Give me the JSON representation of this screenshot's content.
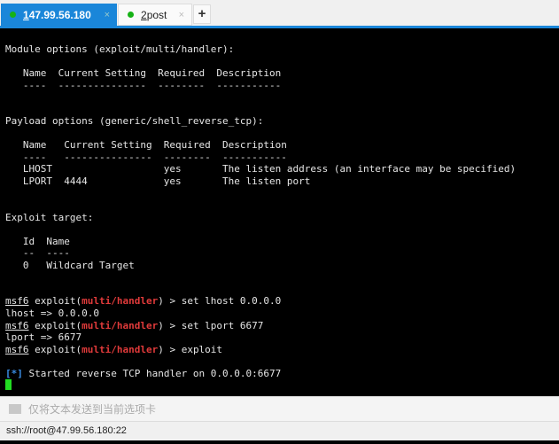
{
  "tabs": [
    {
      "num": "1",
      "label": " 47.99.56.180",
      "active": true,
      "close": "×"
    },
    {
      "num": "2",
      "label": " post",
      "active": false,
      "close": "×"
    }
  ],
  "new_tab": "+",
  "terminal": {
    "lines": [
      [
        [
          "Module options (exploit/multi/handler):",
          ""
        ]
      ],
      [
        [
          "",
          ""
        ]
      ],
      [
        [
          "   Name  Current Setting  Required  Description",
          ""
        ]
      ],
      [
        [
          "   ----  ---------------  --------  -----------",
          ""
        ]
      ],
      [
        [
          "",
          ""
        ]
      ],
      [
        [
          "",
          ""
        ]
      ],
      [
        [
          "Payload options (generic/shell_reverse_tcp):",
          ""
        ]
      ],
      [
        [
          "",
          ""
        ]
      ],
      [
        [
          "   Name   Current Setting  Required  Description",
          ""
        ]
      ],
      [
        [
          "   ----   ---------------  --------  -----------",
          ""
        ]
      ],
      [
        [
          "   LHOST                   yes       The listen address (an interface may be specified)",
          ""
        ]
      ],
      [
        [
          "   LPORT  4444             yes       The listen port",
          ""
        ]
      ],
      [
        [
          "",
          ""
        ]
      ],
      [
        [
          "",
          ""
        ]
      ],
      [
        [
          "Exploit target:",
          ""
        ]
      ],
      [
        [
          "",
          ""
        ]
      ],
      [
        [
          "   Id  Name",
          ""
        ]
      ],
      [
        [
          "   --  ----",
          ""
        ]
      ],
      [
        [
          "   0   Wildcard Target",
          ""
        ]
      ],
      [
        [
          "",
          ""
        ]
      ],
      [
        [
          "",
          ""
        ]
      ],
      [
        [
          "msf6",
          "msf"
        ],
        [
          " exploit(",
          ""
        ],
        [
          "multi/handler",
          "red"
        ],
        [
          ") > set lhost 0.0.0.0",
          ""
        ]
      ],
      [
        [
          "lhost => 0.0.0.0",
          ""
        ]
      ],
      [
        [
          "msf6",
          "msf"
        ],
        [
          " exploit(",
          ""
        ],
        [
          "multi/handler",
          "red"
        ],
        [
          ") > set lport 6677",
          ""
        ]
      ],
      [
        [
          "lport => 6677",
          ""
        ]
      ],
      [
        [
          "msf6",
          "msf"
        ],
        [
          " exploit(",
          ""
        ],
        [
          "multi/handler",
          "red"
        ],
        [
          ") > exploit",
          ""
        ]
      ],
      [
        [
          "",
          ""
        ]
      ],
      [
        [
          "[*]",
          "blue"
        ],
        [
          " Started reverse TCP handler on 0.0.0.0:6677",
          ""
        ]
      ]
    ]
  },
  "send_bar": {
    "placeholder": "仅将文本发送到当前选项卡"
  },
  "status": "ssh://root@47.99.56.180:22",
  "colors": {
    "accent": "#1a86d9",
    "prompt_module": "#e03a3a",
    "info": "#3a8ee6",
    "cursor": "#22dd22"
  }
}
